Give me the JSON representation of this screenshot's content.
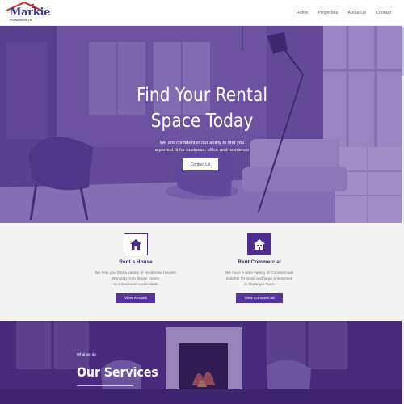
{
  "header": {
    "logo": {
      "name": "Markie",
      "tagline": "Investments Ltd"
    },
    "nav": [
      "Home",
      "Properties",
      "About Us",
      "Contact"
    ]
  },
  "hero": {
    "title_line1": "Find Your Rental",
    "title_line2": "Space Today",
    "subtitle_line1": "We  are confident in our ability to find you",
    "subtitle_line2": "a perfect fit for business, office and residence",
    "button_label": "Contact Us"
  },
  "cards": [
    {
      "icon": "house-icon",
      "title": "Rent a House",
      "text": [
        "We help you find a variety of residential houses;",
        "Ranging from Single rooms",
        "to 3 Bedroom residentials"
      ],
      "button_label": "View Rentals"
    },
    {
      "icon": "building-icon",
      "title": "Rent Commercial",
      "text": [
        "We have a wide variety of Commercials",
        "suitable for small and large enterprises",
        "in Murang'a Town"
      ],
      "button_label": "View Commercial"
    }
  ],
  "services": {
    "kicker": "What we do",
    "title": "Our Services"
  },
  "colors": {
    "brand": "#55349c",
    "brand_dark": "#3d2a6b",
    "hero_overlay": "#5532969a",
    "logo_roof": "#d42a2a"
  }
}
